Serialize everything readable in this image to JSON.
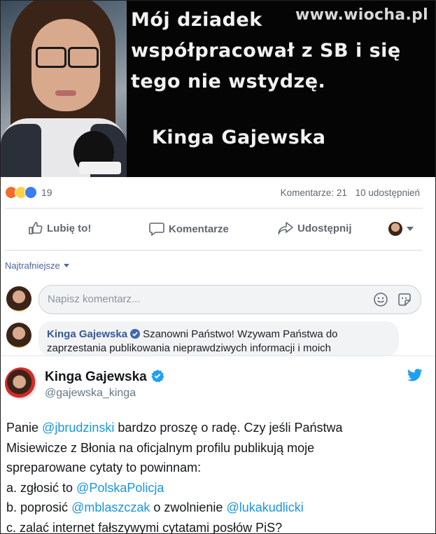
{
  "meme": {
    "lines": [
      "Mój dziadek",
      "współpracował z SB i się",
      "tego nie wstydzę."
    ],
    "signature": "Kinga Gajewska",
    "watermark": "www.wiocha.pl"
  },
  "post": {
    "reaction_count": "19",
    "comments_stat": "Komentarze: 21",
    "shares_stat": "10 udostępnień",
    "actions": {
      "like": "Lubię to!",
      "comment": "Komentarze",
      "share": "Udostępnij"
    },
    "sort_label": "Najtrafniejsze",
    "comment_placeholder": "Napisz komentarz...",
    "reply": {
      "author": "Kinga Gajewska",
      "text": "Szanowni Państwo! Wzywam Państwa do zaprzestania publikowania nieprawdziwych informacji i moich"
    },
    "colors": {
      "link": "#385898",
      "reaction_like": "#3b7df2",
      "reaction_angry": "#f26b2c",
      "reaction_haha": "#ffd146"
    }
  },
  "tweet": {
    "name": "Kinga Gajewska",
    "handle": "@gajewska_kinga",
    "p1_a": "Panie ",
    "p1_mention": "@jbrudzinski",
    "p1_b": " bardzo proszę o radę. Czy jeśli Państwa",
    "p2": "Misiewicze z Błonia na oficjalnym profilu publikują moje",
    "p3": "spreparowane cytaty to powinnam:",
    "a_text": "a. zgłosić to ",
    "a_mention": "@PolskaPolicja",
    "b_text": "b. poprosić ",
    "b_mention": "@mblaszczak",
    "b_mid": " o zwolnienie ",
    "b_mention2": "@lukakudlicki",
    "c_text": "c. zalać internet fałszywymi cytatami posłów PiS?",
    "colors": {
      "mention": "#1b95e0",
      "verified": "#1da1f2"
    }
  }
}
